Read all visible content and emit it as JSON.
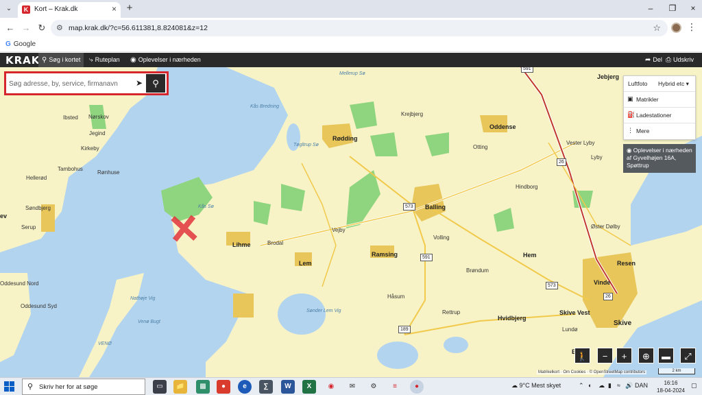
{
  "browser": {
    "tab_title": "Kort – Krak.dk",
    "favicon_letter": "K",
    "url": "map.krak.dk/?c=56.611381,8.824081&z=12",
    "bookmark": "Google",
    "bookmark_letter": "G"
  },
  "krak": {
    "logo": "KRAK",
    "nav": [
      {
        "label": "Søg i kortet",
        "icon": "magnifier-icon"
      },
      {
        "label": "Ruteplan",
        "icon": "route-icon"
      },
      {
        "label": "Oplevelser i nærheden",
        "icon": "binoculars-icon"
      }
    ],
    "share": "Del",
    "print": "Udskriv"
  },
  "search": {
    "placeholder": "Søg adresse, by, service, firmanavn"
  },
  "layers": {
    "aerial": "Luftfoto",
    "hybrid": "Hybrid etc",
    "items": [
      "Matrikler",
      "Ladestationer",
      "Mere"
    ]
  },
  "nearby_panel": "Oplevelser i nærheden af Gyvelhøjen 16A, Spøttrup",
  "map_labels": {
    "towns_big": [
      "Lihme",
      "Lem",
      "Ramsing",
      "Balling",
      "Hem",
      "Oddense",
      "Resen",
      "Vinde",
      "Skive Vest",
      "Skive",
      "Hvidbjerg",
      "Rødding",
      "Jebjerg"
    ],
    "towns": [
      "Ibsted",
      "Nørskov",
      "Jegind",
      "Kirkeby",
      "Tambohus",
      "Rønhuse",
      "Hellerød",
      "Søndbjerg",
      "Serup",
      "ev",
      "Oddesund Nord",
      "Oddesund Syd",
      "Krejbjerg",
      "Otting",
      "Vester Lyby",
      "Lyby",
      "Hindborg",
      "Øster Dølby",
      "Brodal",
      "Vejby",
      "Volling",
      "Brøndum",
      "Håsum",
      "Rettrup",
      "Eg",
      "Lundø"
    ],
    "water": [
      "Kås Bredning",
      "Tøgltrup Sø",
      "Kås Sø",
      "Nathøje Vig",
      "Venø Bugt",
      "VENØ",
      "Sønder Lem Vig",
      "Mellerup Sø"
    ],
    "roads": [
      "591",
      "573",
      "591",
      "26",
      "26",
      "573",
      "189"
    ]
  },
  "map_attribution": "Matrikelkort · Om Cookies · © OpenStreetMap contributors",
  "scale_label": "2 km",
  "taskbar": {
    "search_placeholder": "Skriv her for at søge",
    "weather": "9°C  Mest skyet",
    "lang": "DAN",
    "time": "16:16",
    "date": "18-04-2024"
  },
  "colors": {
    "krak_red": "#d6262d",
    "land": "#f7f3c6",
    "water": "#b3d4ee",
    "forest": "#8fd47e",
    "town": "#e8c659",
    "motorway": "#c0392b"
  }
}
